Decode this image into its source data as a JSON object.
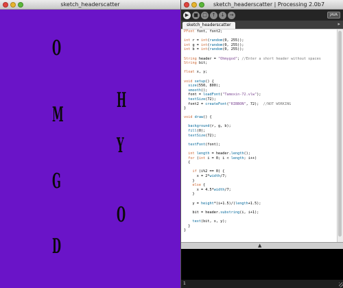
{
  "sketch_window": {
    "title": "sketch_headerscatter",
    "background": "#6a14c8",
    "glyph_color": "#0a0a0a",
    "letters": [
      "O",
      "H",
      "M",
      "Y",
      "G",
      "O",
      "D"
    ]
  },
  "ide_window": {
    "title": "sketch_headerscatter | Processing 2.0b7",
    "mode_label": "JAVA",
    "tab_label": "sketch_headerscatter",
    "tab_menu_icon": "triangle-right-icon",
    "toolbar_buttons": [
      {
        "name": "run",
        "glyph": "▶"
      },
      {
        "name": "stop",
        "glyph": "■"
      },
      {
        "name": "new",
        "glyph": "□"
      },
      {
        "name": "open",
        "glyph": "↑"
      },
      {
        "name": "save",
        "glyph": "↓"
      },
      {
        "name": "export",
        "glyph": "→"
      }
    ],
    "code_lines": [
      "PFont font, font2;",
      "",
      "int r = int(random(0, 255));",
      "int g = int(random(0, 255));",
      "int b = int(random(0, 255));",
      "",
      "String header = \"Ohmygod\"; //Enter a short header without spaces",
      "String bit;",
      "",
      "float x, y;",
      "",
      "void setup() {",
      "  size(550, 800);",
      "  smooth();",
      "  font = loadFont(\"Tamoxin-72.vlw\");",
      "  textSize(72);",
      "  font2 = createFont(\"RIBBON\", 72);  //NOT WORKING",
      "}",
      "",
      "void draw() {",
      "",
      "  background(r, g, b);",
      "  fill(0);",
      "  textSize(72);",
      "",
      "  textFont(font);",
      "",
      "  int length = header.length();",
      "  for (int i = 0; i < length; i++)",
      "  {",
      "",
      "    if (i%2 == 0) {",
      "      x = 2*width/7;",
      "    }",
      "    else {",
      "      x = 4.5*width/7;",
      "    }",
      "",
      "    y = height*(i+1.5)/(length+1.5);",
      "",
      "    bit = header.substring(i, i+1);",
      "",
      "    text(bit, x, y);",
      "  }",
      "}"
    ],
    "divider_icon": "triangle-up-icon",
    "status_line_number": "1"
  }
}
